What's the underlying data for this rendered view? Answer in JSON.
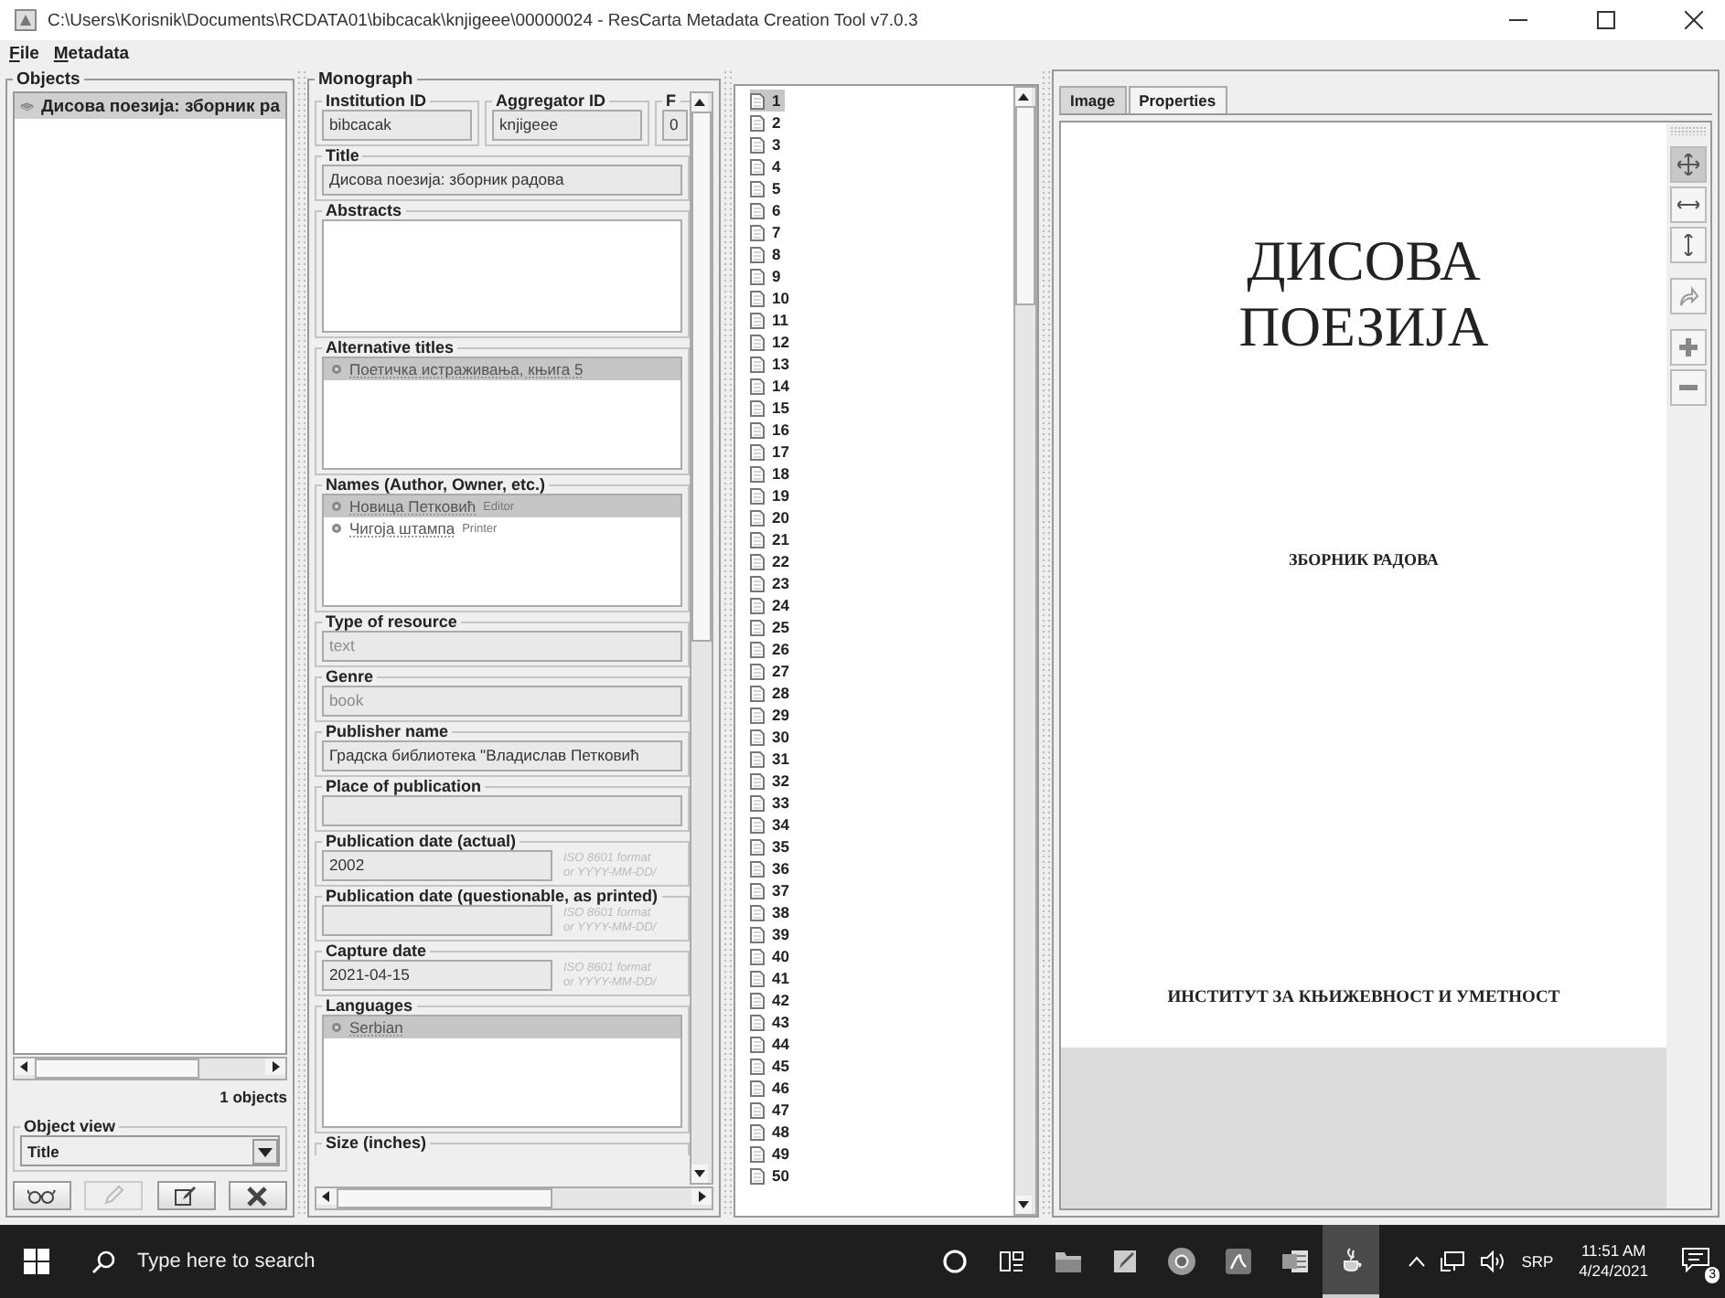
{
  "window": {
    "title": "C:\\Users\\Korisnik\\Documents\\RCDATA01\\bibcacak\\knjigeee\\00000024 - ResCarta Metadata Creation Tool v7.0.3"
  },
  "menu": [
    "File",
    "Metadata"
  ],
  "objects": {
    "title": "Objects",
    "items": [
      {
        "label": "Дисова поезија: зборник ра",
        "selected": true
      }
    ],
    "count": "1 objects",
    "object_view": {
      "label": "Object view",
      "value": "Title"
    },
    "buttons": [
      {
        "kind": "view",
        "disabled": false
      },
      {
        "kind": "edit",
        "disabled": true
      },
      {
        "kind": "form",
        "disabled": false
      },
      {
        "kind": "delete",
        "disabled": false
      }
    ]
  },
  "monograph": {
    "title": "Monograph",
    "fields": [
      {
        "kind": "pair",
        "fields": [
          {
            "label": "Institution ID",
            "value": "bibcacak"
          },
          {
            "label": "Aggregator ID",
            "value": "knjigeee"
          },
          {
            "label": "F",
            "value": "0"
          }
        ]
      },
      {
        "kind": "text",
        "label": "Title",
        "value": "Дисова поезија: зборник радова",
        "disabled": false
      },
      {
        "kind": "list",
        "label": "Abstracts"
      },
      {
        "kind": "list",
        "label": "Alternative titles",
        "items": [
          {
            "text": "Поетичка истраживања, књига 5",
            "selected": true
          }
        ]
      },
      {
        "kind": "list",
        "label": "Names (Author, Owner, etc.)",
        "items": [
          {
            "text": "Новица Петковић",
            "role": "Editor",
            "selected": true
          },
          {
            "text": "Чигоја штампа",
            "role": "Printer",
            "selected": false
          }
        ]
      },
      {
        "kind": "text",
        "label": "Type of resource",
        "value": "text",
        "disabled": true
      },
      {
        "kind": "text",
        "label": "Genre",
        "value": "book",
        "disabled": true
      },
      {
        "kind": "text",
        "label": "Publisher name",
        "value": "Градска библиотека \"Владислав Петковић",
        "disabled": false
      },
      {
        "kind": "text",
        "label": "Place of publication"
      },
      {
        "kind": "date",
        "label": "Publication date (actual)",
        "value": "2002",
        "hint": [
          "ISO 8601 format",
          "or YYYY-MM-DD/"
        ]
      },
      {
        "kind": "date",
        "label": "Publication date (questionable, as printed)",
        "hint": [
          "ISO 8601 format",
          "or YYYY-MM-DD/"
        ]
      },
      {
        "kind": "date",
        "label": "Capture date",
        "value": "2021-04-15",
        "hint": [
          "ISO 8601 format",
          "or YYYY-MM-DD/"
        ]
      },
      {
        "kind": "list",
        "label": "Languages",
        "items": [
          {
            "text": "Serbian",
            "selected": true
          }
        ]
      },
      {
        "kind": "heading",
        "label": "Size (inches)"
      }
    ]
  },
  "pages": [
    {
      "label": "1",
      "selected": true
    },
    {
      "label": "2",
      "selected": false
    },
    {
      "label": "3",
      "selected": false
    },
    {
      "label": "4",
      "selected": false
    },
    {
      "label": "5",
      "selected": false
    },
    {
      "label": "6",
      "selected": false
    },
    {
      "label": "7",
      "selected": false
    },
    {
      "label": "8",
      "selected": false
    },
    {
      "label": "9",
      "selected": false
    },
    {
      "label": "10",
      "selected": false
    },
    {
      "label": "11",
      "selected": false
    },
    {
      "label": "12",
      "selected": false
    },
    {
      "label": "13",
      "selected": false
    },
    {
      "label": "14",
      "selected": false
    },
    {
      "label": "15",
      "selected": false
    },
    {
      "label": "16",
      "selected": false
    },
    {
      "label": "17",
      "selected": false
    },
    {
      "label": "18",
      "selected": false
    },
    {
      "label": "19",
      "selected": false
    },
    {
      "label": "20",
      "selected": false
    },
    {
      "label": "21",
      "selected": false
    },
    {
      "label": "22",
      "selected": false
    },
    {
      "label": "23",
      "selected": false
    },
    {
      "label": "24",
      "selected": false
    },
    {
      "label": "25",
      "selected": false
    },
    {
      "label": "26",
      "selected": false
    },
    {
      "label": "27",
      "selected": false
    },
    {
      "label": "28",
      "selected": false
    },
    {
      "label": "29",
      "selected": false
    },
    {
      "label": "30",
      "selected": false
    },
    {
      "label": "31",
      "selected": false
    },
    {
      "label": "32",
      "selected": false
    },
    {
      "label": "33",
      "selected": false
    },
    {
      "label": "34",
      "selected": false
    },
    {
      "label": "35",
      "selected": false
    },
    {
      "label": "36",
      "selected": false
    },
    {
      "label": "37",
      "selected": false
    },
    {
      "label": "38",
      "selected": false
    },
    {
      "label": "39",
      "selected": false
    },
    {
      "label": "40",
      "selected": false
    },
    {
      "label": "41",
      "selected": false
    },
    {
      "label": "42",
      "selected": false
    },
    {
      "label": "43",
      "selected": false
    },
    {
      "label": "44",
      "selected": false
    },
    {
      "label": "45",
      "selected": false
    },
    {
      "label": "46",
      "selected": false
    },
    {
      "label": "47",
      "selected": false
    },
    {
      "label": "48",
      "selected": false
    },
    {
      "label": "49",
      "selected": false
    },
    {
      "label": "50",
      "selected": false
    }
  ],
  "viewer": {
    "tabs": [
      {
        "label": "Image",
        "selected": true
      },
      {
        "label": "Properties",
        "selected": false
      }
    ],
    "page_lines": [
      {
        "kind": "title",
        "text": "ДИСОВА"
      },
      {
        "kind": "title",
        "text": "ПОЕЗИЈА"
      },
      {
        "kind": "subtitle",
        "text": "ЗБОРНИК РАДОВА"
      },
      {
        "kind": "footer",
        "text": "ИНСТИТУТ ЗА КЊИЖЕВНОСТ И УМЕТНОСТ"
      }
    ],
    "tools": [
      {
        "kind": "move",
        "selected": true
      },
      {
        "kind": "fit-width",
        "selected": false
      },
      {
        "kind": "fit-height",
        "selected": false
      },
      {
        "kind": "rotate",
        "selected": false
      },
      {
        "kind": "zoom-in",
        "selected": false
      },
      {
        "kind": "zoom-out",
        "selected": false
      }
    ]
  },
  "taskbar": {
    "search": {
      "placeholder": "Type here to search"
    },
    "apps": [
      {
        "kind": "cortana",
        "selected": false
      },
      {
        "kind": "task-view",
        "selected": false
      },
      {
        "kind": "folder",
        "selected": false
      },
      {
        "kind": "notes",
        "selected": false
      },
      {
        "kind": "browser",
        "selected": false
      },
      {
        "kind": "pdf",
        "selected": false
      },
      {
        "kind": "word",
        "selected": false
      },
      {
        "kind": "java",
        "selected": true
      }
    ],
    "language": "SRP",
    "time": "11:51 AM",
    "date": "4/24/2021",
    "notifications": "3"
  }
}
